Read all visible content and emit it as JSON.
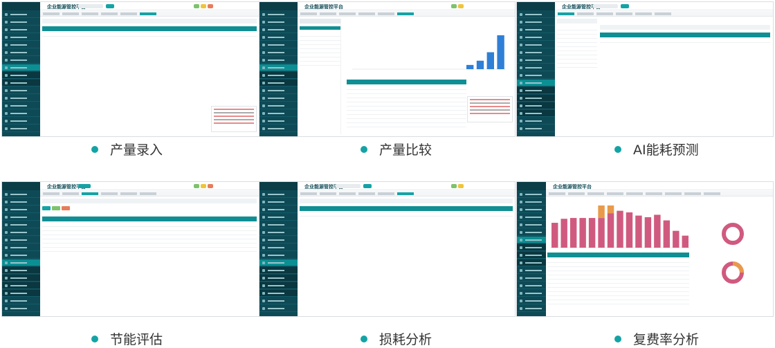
{
  "app_title": "企业能源管控平台",
  "captions": [
    "产量录入",
    "产量比较",
    "AI能耗预测",
    "节能评估",
    "损耗分析",
    "复费率分析"
  ],
  "colors": {
    "sidebar": "#0e4a56",
    "accent": "#0f8f94",
    "bar_blue": "#2f7fd6",
    "bar_pink": "#d05a7f",
    "bar_orange": "#e89a4a",
    "dot": "#14a3a5"
  },
  "chart_blue_values": [
    0,
    0,
    0,
    0,
    0,
    0,
    0,
    0,
    0,
    0,
    0,
    1,
    2,
    4,
    8
  ],
  "chart_pink_values": [
    62,
    72,
    74,
    74,
    74,
    74,
    86,
    92,
    88,
    80,
    76,
    82,
    68,
    42,
    30
  ],
  "chart_orange_values": [
    0,
    0,
    0,
    0,
    0,
    50,
    64,
    0,
    0,
    0,
    0,
    0,
    0,
    0,
    0
  ]
}
